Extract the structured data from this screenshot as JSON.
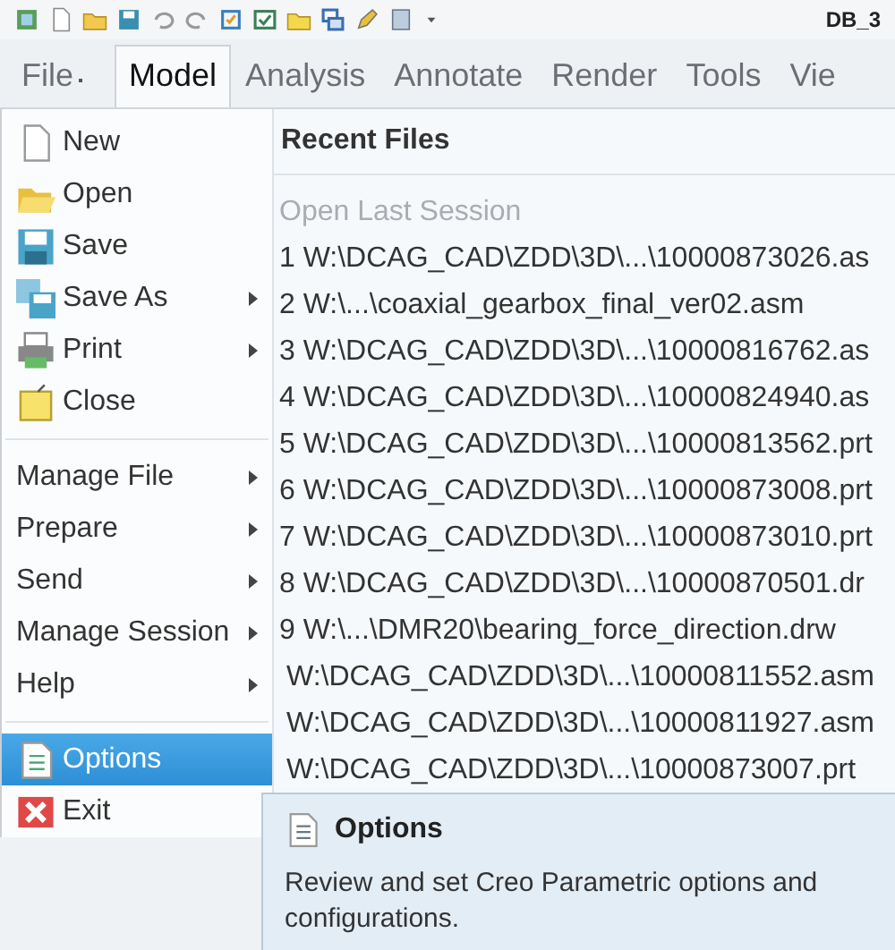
{
  "window": {
    "title": "DB_3"
  },
  "tabs": [
    {
      "label": "File",
      "selected": false,
      "kind": "menu"
    },
    {
      "label": "Model",
      "selected": true,
      "kind": "tab"
    },
    {
      "label": "Analysis",
      "selected": false,
      "kind": "tab"
    },
    {
      "label": "Annotate",
      "selected": false,
      "kind": "tab"
    },
    {
      "label": "Render",
      "selected": false,
      "kind": "tab"
    },
    {
      "label": "Tools",
      "selected": false,
      "kind": "tab"
    },
    {
      "label": "Vie",
      "selected": false,
      "kind": "tab"
    }
  ],
  "menu": {
    "groups": [
      {
        "items": [
          {
            "label": "New",
            "has_submenu": false,
            "selected": false
          },
          {
            "label": "Open",
            "has_submenu": false,
            "selected": false
          },
          {
            "label": "Save",
            "has_submenu": false,
            "selected": false
          },
          {
            "label": "Save As",
            "has_submenu": true,
            "selected": false
          },
          {
            "label": "Print",
            "has_submenu": true,
            "selected": false
          },
          {
            "label": "Close",
            "has_submenu": false,
            "selected": false
          }
        ]
      },
      {
        "items": [
          {
            "label": "Manage File",
            "has_submenu": true,
            "selected": false
          },
          {
            "label": "Prepare",
            "has_submenu": true,
            "selected": false
          },
          {
            "label": "Send",
            "has_submenu": true,
            "selected": false
          },
          {
            "label": "Manage Session",
            "has_submenu": true,
            "selected": false
          },
          {
            "label": "Help",
            "has_submenu": true,
            "selected": false
          }
        ]
      },
      {
        "items": [
          {
            "label": "Options",
            "has_submenu": false,
            "selected": true
          },
          {
            "label": "Exit",
            "has_submenu": false,
            "selected": false
          }
        ]
      }
    ]
  },
  "recent_files": {
    "title": "Recent Files",
    "open_last_session": {
      "label": "Open Last Session",
      "disabled": true
    },
    "files": [
      "1 W:\\DCAG_CAD\\ZDD\\3D\\...\\10000873026.as",
      "2 W:\\...\\coaxial_gearbox_final_ver02.asm",
      "3 W:\\DCAG_CAD\\ZDD\\3D\\...\\10000816762.as",
      "4 W:\\DCAG_CAD\\ZDD\\3D\\...\\10000824940.as",
      "5 W:\\DCAG_CAD\\ZDD\\3D\\...\\10000813562.prt",
      "6 W:\\DCAG_CAD\\ZDD\\3D\\...\\10000873008.prt",
      "7 W:\\DCAG_CAD\\ZDD\\3D\\...\\10000873010.prt",
      "8 W:\\DCAG_CAD\\ZDD\\3D\\...\\10000870501.dr",
      "9 W:\\...\\DMR20\\bearing_force_direction.drw",
      "W:\\DCAG_CAD\\ZDD\\3D\\...\\10000811552.asm",
      "W:\\DCAG_CAD\\ZDD\\3D\\...\\10000811927.asm",
      "W:\\DCAG_CAD\\ZDD\\3D\\...\\10000873007.prt"
    ]
  },
  "tooltip": {
    "title": "Options",
    "text": "Review and set Creo Parametric options and configurations."
  }
}
